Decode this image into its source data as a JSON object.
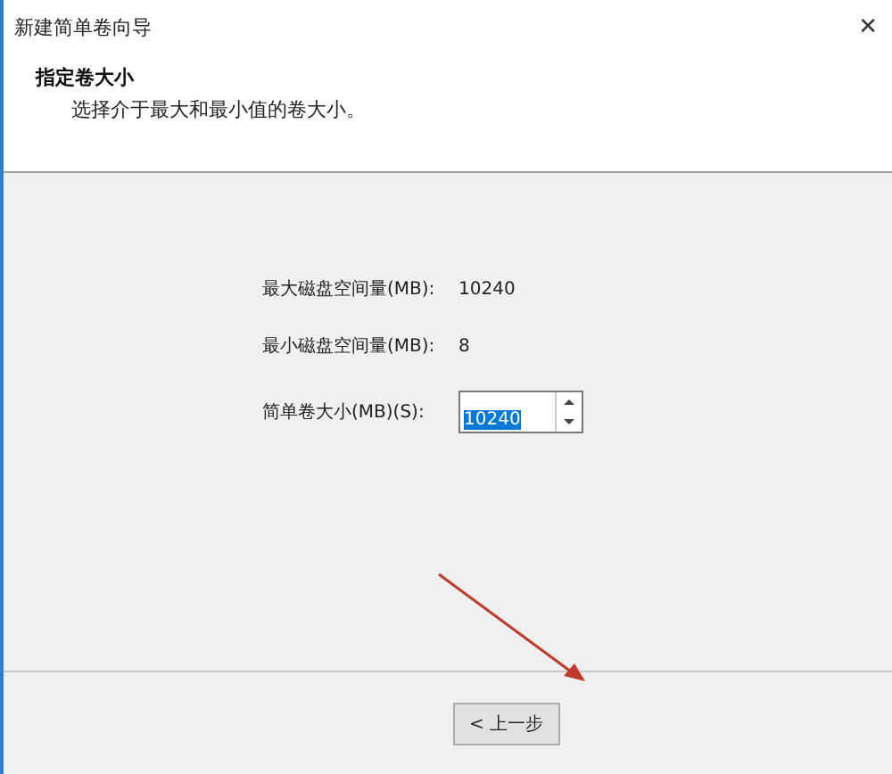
{
  "window": {
    "title": "新建简单卷向导",
    "close": "✕"
  },
  "header": {
    "title": "指定卷大小",
    "subtitle": "选择介于最大和最小值的卷大小。"
  },
  "fields": [
    {
      "kind": "readout",
      "label": "最大磁盘空间量(MB):",
      "value": "10240"
    },
    {
      "kind": "readout",
      "label": "最小磁盘空间量(MB):",
      "value": "8"
    },
    {
      "kind": "spin",
      "label": "简单卷大小(MB)(S):",
      "value": "10240",
      "selected": true
    }
  ],
  "buttons": [
    "< 上一步"
  ]
}
